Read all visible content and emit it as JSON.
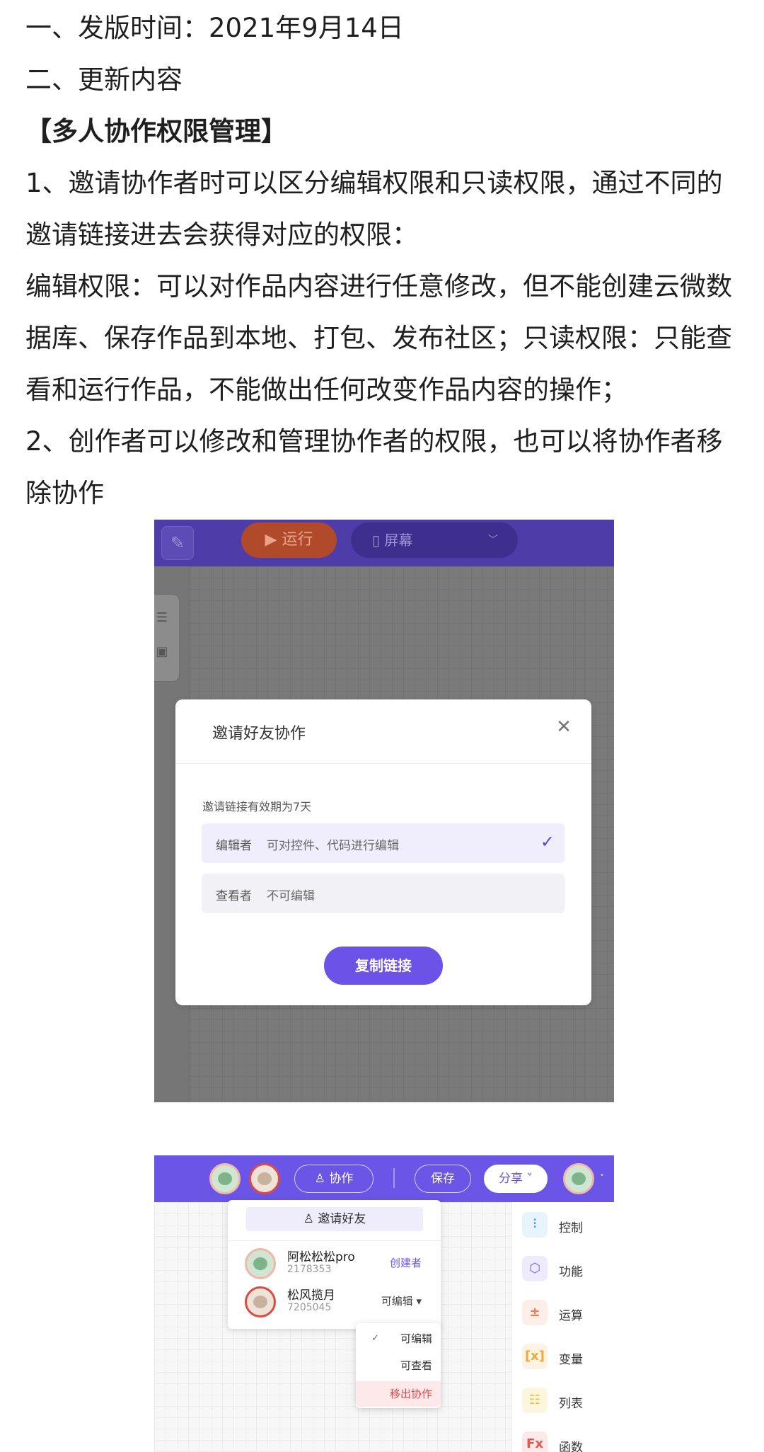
{
  "article": {
    "line1": "一、发版时间：2021年9月14日",
    "line2": "二、更新内容",
    "heading": "【多人协作权限管理】",
    "para1": "1、邀请协作者时可以区分编辑权限和只读权限，通过不同的邀请链接进去会获得对应的权限：",
    "para2": "编辑权限：可以对作品内容进行任意修改，但不能创建云微数据库、保存作品到本地、打包、发布社区；只读权限：只能查看和运行作品，不能做出任何改变作品内容的操作；",
    "para3": "2、创作者可以修改和管理协作者的权限，也可以将协作者移除协作"
  },
  "shot1": {
    "run_label": "▶ 运行",
    "screen_label": "屏幕",
    "modal": {
      "title": "邀请好友协作",
      "note": "邀请链接有效期为7天",
      "options": [
        {
          "key": "编辑者",
          "desc": "可对控件、代码进行编辑",
          "selected": true
        },
        {
          "key": "查看者",
          "desc": "不可编辑",
          "selected": false
        }
      ],
      "copy_button": "复制链接"
    }
  },
  "shot2": {
    "collab_label": "协作",
    "save_label": "保存",
    "share_label": "分享",
    "invite_label": "邀请好友",
    "members": [
      {
        "name": "阿松松松pro",
        "id": "2178353",
        "role": "创建者"
      },
      {
        "name": "松风揽月",
        "id": "7205045",
        "role": "可编辑 ▾"
      }
    ],
    "perm_menu": {
      "editable": "可编辑",
      "viewable": "可查看",
      "remove": "移出协作"
    },
    "sidebar": [
      "控制",
      "功能",
      "运算",
      "变量",
      "列表",
      "函数"
    ],
    "colors": {
      "accent": "#6b55e6",
      "danger": "#e04848"
    }
  }
}
